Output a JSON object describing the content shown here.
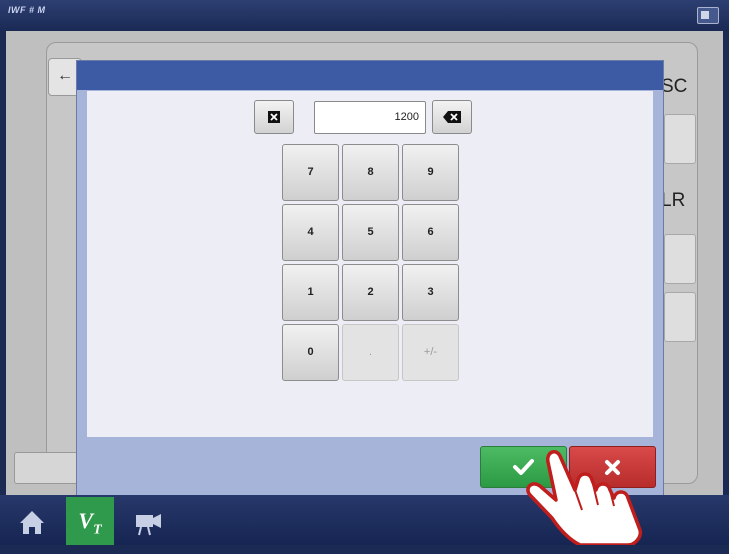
{
  "status_bar": {
    "left_text": "IWF # M"
  },
  "background": {
    "tab_symbol": "←",
    "right_labels": [
      "SC",
      "LR"
    ]
  },
  "keypad": {
    "value": "1200",
    "keys": [
      "7",
      "8",
      "9",
      "4",
      "5",
      "6",
      "1",
      "2",
      "3",
      "0",
      ".",
      "+/-"
    ]
  },
  "dialog_buttons": {
    "ok_icon": "checkmark-icon",
    "cancel_icon": "close-icon"
  },
  "colors": {
    "ok": "#3aa651",
    "cancel": "#c83535",
    "header": "#3d5aa4",
    "nav_active": "#2f9a4b"
  },
  "nav": {
    "vt_label": "V",
    "vt_sub": "T"
  }
}
